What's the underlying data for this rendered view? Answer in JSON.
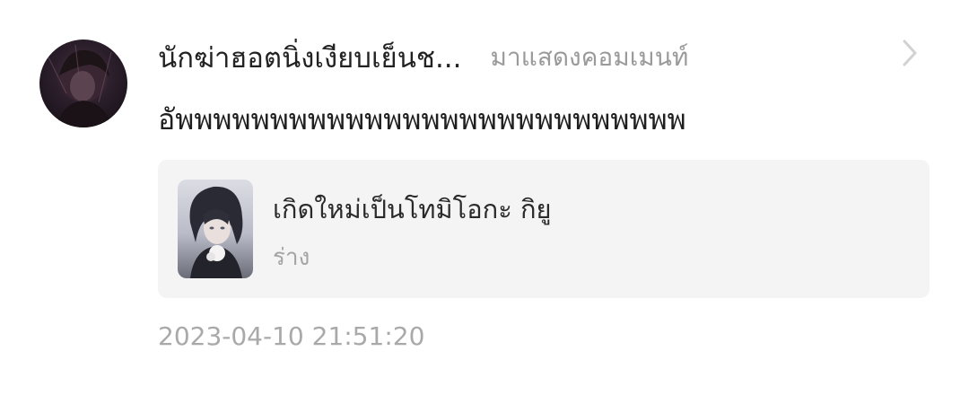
{
  "comment": {
    "avatar_icon": "user-avatar-dark-portrait",
    "username": "นักฆ่าฮอตนิ่งเงียบเย็นช...",
    "action_text": "มาแสดงคอมเมนท์",
    "chevron_icon": "chevron-right-icon",
    "text": "อัพพพพพพพพพพพพพพพพพพพพพพพพพพพ",
    "timestamp": "2023-04-10 21:51:20"
  },
  "linked_work": {
    "cover_icon": "anime-character-cover",
    "title": "เกิดใหม่เป็นโทมิโอกะ กิยู",
    "status": "ร่าง"
  },
  "colors": {
    "username": "#222222",
    "action_text": "#9a9a9a",
    "card_background": "#f4f4f5",
    "timestamp": "#a9a9a9"
  }
}
